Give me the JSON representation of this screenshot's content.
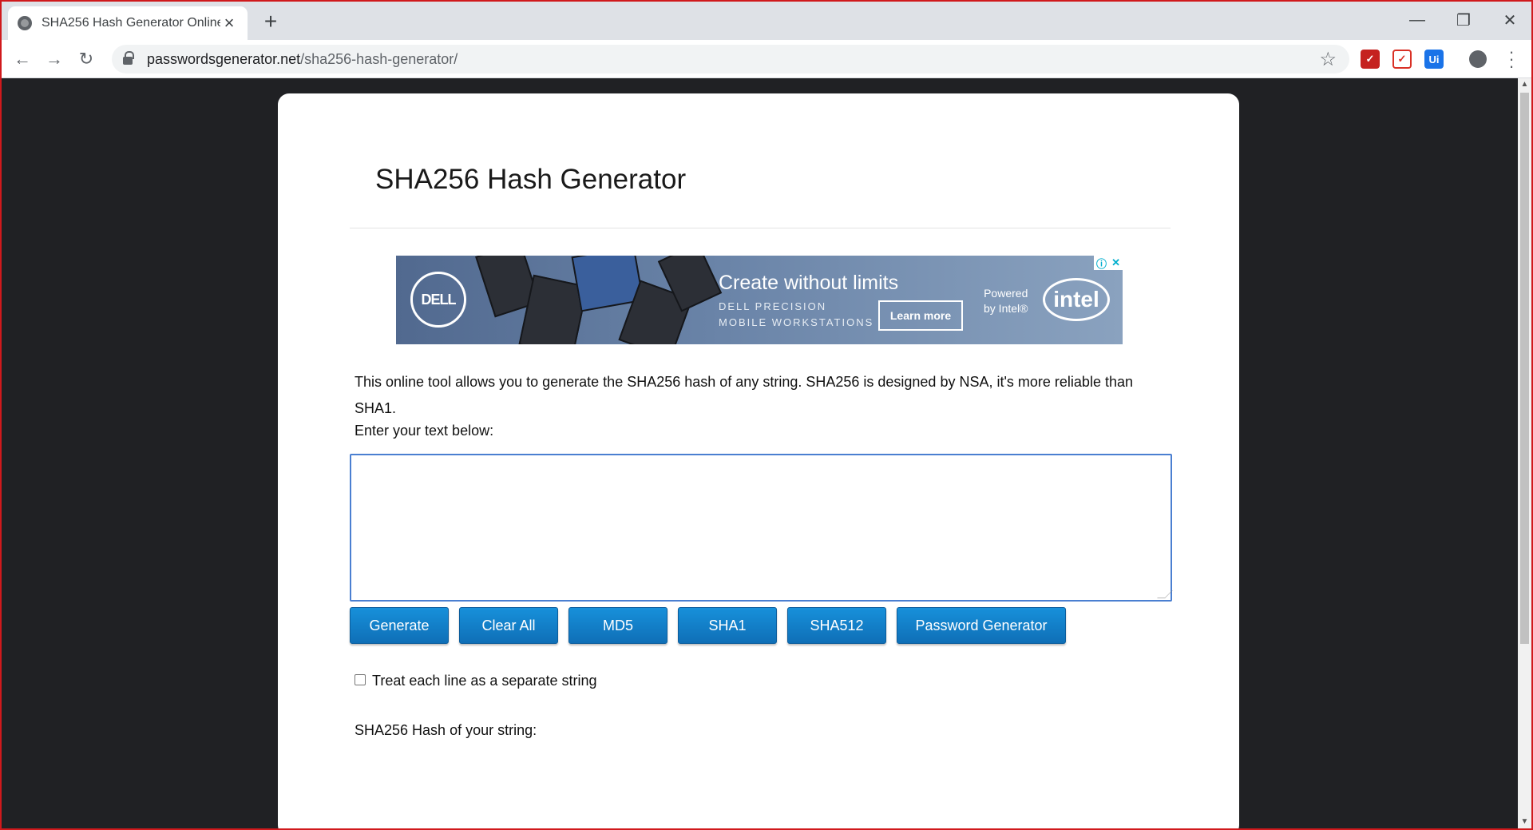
{
  "browser": {
    "tab_title": "SHA256 Hash Generator Online",
    "url_host": "passwordsgenerator.net",
    "url_path": "/sha256-hash-generator/",
    "extensions": [
      {
        "name": "extension-red-shield",
        "glyph": "✓",
        "color": "#c5221f"
      },
      {
        "name": "extension-pdf",
        "glyph": "✓",
        "color": "#d93025"
      },
      {
        "name": "extension-ui",
        "glyph": "Ui",
        "color": "#1a73e8"
      }
    ]
  },
  "page": {
    "title": "SHA256 Hash Generator",
    "description": "This online tool allows you to generate the SHA256 hash of any string. SHA256 is designed by NSA, it's more reliable than SHA1.",
    "enter_label": "Enter your text below:",
    "input_value": "",
    "buttons": {
      "generate": "Generate",
      "clear_all": "Clear All",
      "md5": "MD5",
      "sha1": "SHA1",
      "sha512": "SHA512",
      "password_generator": "Password Generator"
    },
    "checkbox_label": "Treat each line as a separate string",
    "checkbox_checked": false,
    "result_label": "SHA256 Hash of your string:"
  },
  "ad": {
    "brand": "DELL",
    "headline": "Create without limits",
    "subline_1": "DELL PRECISION",
    "subline_2": "MOBILE WORKSTATIONS",
    "cta": "Learn more",
    "powered_1": "Powered",
    "powered_2": "by Intel®",
    "partner": "intel"
  },
  "colors": {
    "accent": "#1584d2",
    "focus": "#4a7fd1",
    "window_border": "#d0191c"
  }
}
